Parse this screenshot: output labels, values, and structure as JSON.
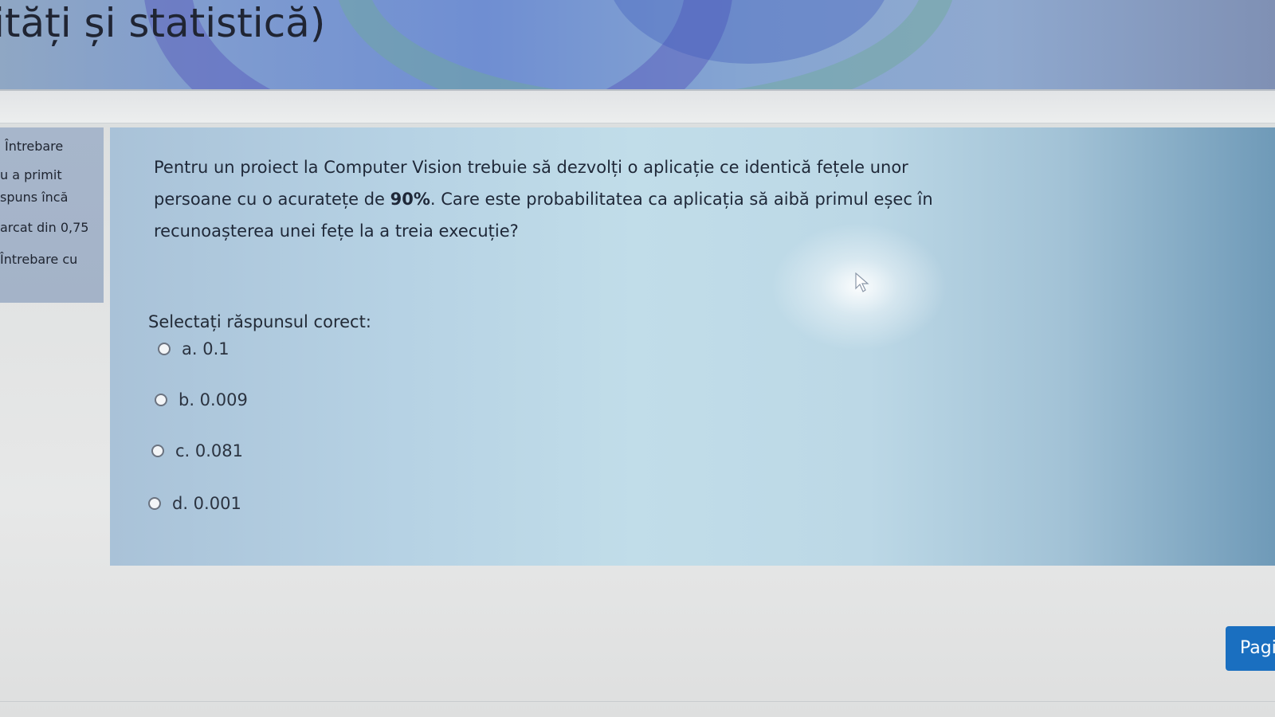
{
  "header": {
    "title": "ități și statistică)"
  },
  "info": {
    "lines": [
      "Întrebare",
      "u a primit",
      "spuns încă",
      "arcat din 0,75",
      "Întrebare cu"
    ]
  },
  "question": {
    "text_line1": "Pentru un proiect la Computer Vision trebuie să dezvolți o aplicație ce identică fețele unor",
    "text_line2_before": "persoane cu o acuratețe de ",
    "text_line2_bold": "90%",
    "text_line2_after": ". Care este probabilitatea ca aplicația să aibă primul eșec în",
    "text_line3": "recunoașterea unei fețe la a treia execuție?",
    "prompt": "Selectați răspunsul corect:",
    "options": [
      {
        "label": "a. 0.1"
      },
      {
        "label": "b. 0.009"
      },
      {
        "label": "c. 0.081"
      },
      {
        "label": "d. 0.001"
      }
    ]
  },
  "navigation": {
    "next_label": "Pagi"
  },
  "colors": {
    "button": "#1a6fc0",
    "panel": "#bcd8e6",
    "info_panel": "#a7b6cb"
  },
  "icons": [
    "cursor-icon",
    "radio-icon"
  ]
}
